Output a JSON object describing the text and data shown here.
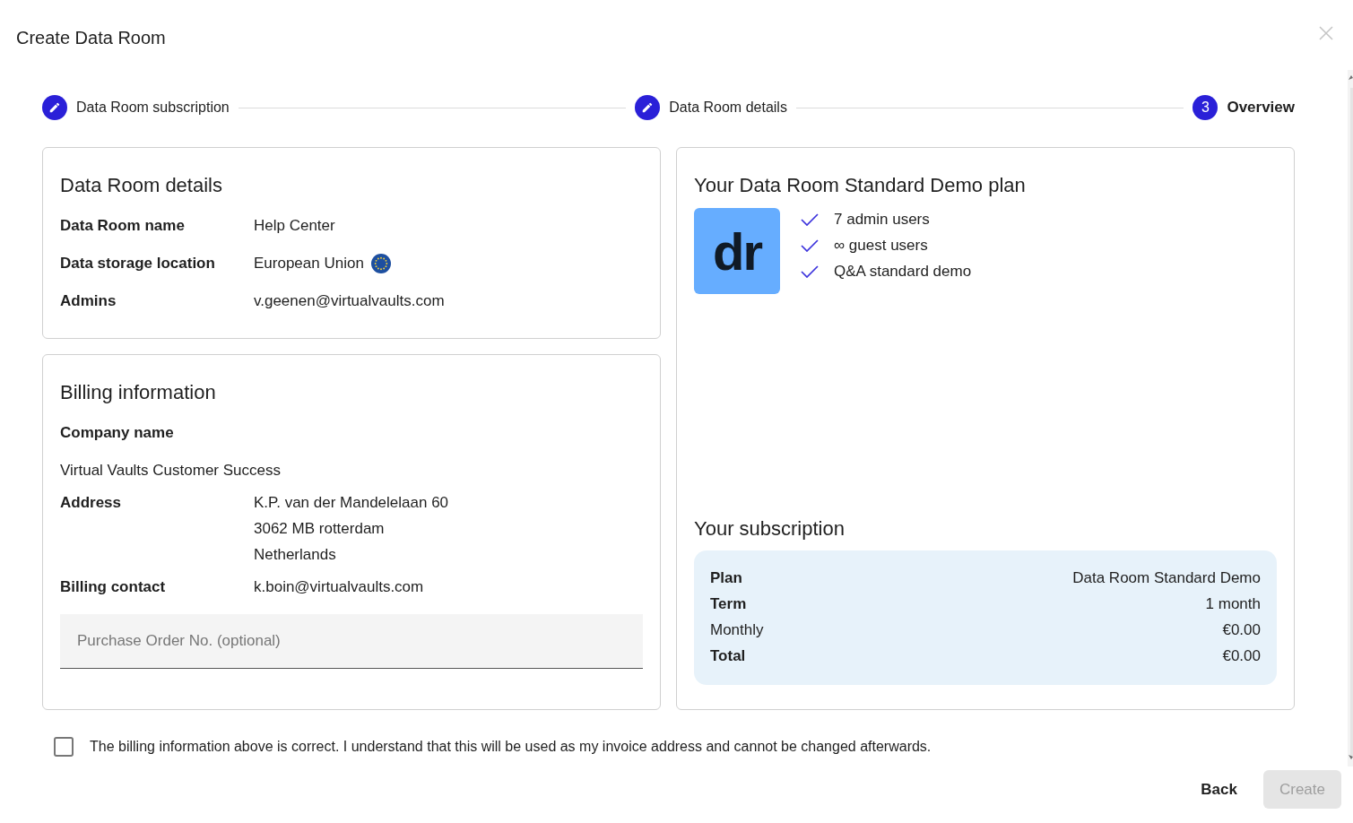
{
  "dialog": {
    "title": "Create Data Room"
  },
  "steps": [
    {
      "label": "Data Room subscription",
      "kind": "edit",
      "selected": false
    },
    {
      "label": "Data Room details",
      "kind": "edit",
      "selected": false
    },
    {
      "label": "Overview",
      "kind": "number",
      "number": "3",
      "selected": true
    }
  ],
  "data_room_details": {
    "title": "Data Room details",
    "fields": [
      {
        "label": "Data Room name",
        "kind": "inline",
        "lines": [
          "Help Center"
        ]
      },
      {
        "label": "Data storage location",
        "kind": "region",
        "lines": [
          "European Union"
        ]
      },
      {
        "label": "Admins",
        "kind": "inline",
        "lines": [
          "v.geenen@virtualvaults.com"
        ]
      }
    ]
  },
  "billing_information": {
    "title": "Billing information",
    "fields": [
      {
        "label": "Company name",
        "kind": "stacked",
        "lines": [
          "Virtual Vaults Customer Success"
        ]
      },
      {
        "label": "Address",
        "kind": "inline",
        "lines": [
          "K.P. van der Mandelelaan 60",
          "3062 MB rotterdam",
          "Netherlands"
        ]
      },
      {
        "label": "Billing contact",
        "kind": "inline",
        "lines": [
          "k.boin@virtualvaults.com"
        ]
      }
    ],
    "purchase_order": {
      "placeholder": "Purchase Order No. (optional)"
    }
  },
  "plan": {
    "title": "Your Data Room Standard Demo plan",
    "logo_text": "dr",
    "features": [
      "7 admin users",
      "∞ guest users",
      "Q&A standard demo"
    ]
  },
  "subscription": {
    "title": "Your subscription",
    "rows": [
      {
        "label": "Plan",
        "value": "Data Room Standard Demo",
        "strong": true
      },
      {
        "label": "Term",
        "value": "1 month",
        "strong": true
      },
      {
        "label": "Monthly",
        "value": "€0.00",
        "strong": false
      },
      {
        "label": "Total",
        "value": "€0.00",
        "strong": true
      }
    ]
  },
  "agreement": {
    "text": "The billing information above is correct. I understand that this will be used as my invoice address and cannot be changed afterwards.",
    "checked": false
  },
  "actions": [
    {
      "label": "Back",
      "kind": "text",
      "disabled": false
    },
    {
      "label": "Create",
      "kind": "filled",
      "disabled": true
    }
  ]
}
